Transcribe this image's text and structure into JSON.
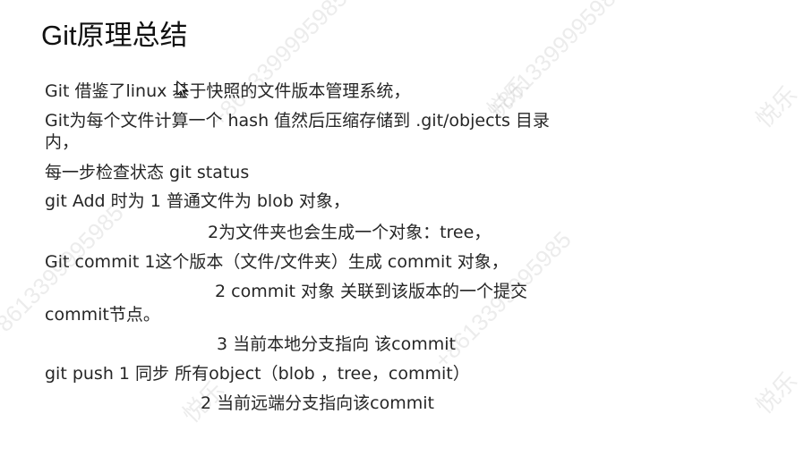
{
  "slide": {
    "title": "Git原理总结",
    "lines": [
      "Git 借鉴了linux 基于快照的文件版本管理系统，",
      "Git为每个文件计算一个 hash 值然后压缩存储到 .git/objects 目录",
      "内，",
      "每一步检查状态 git status",
      "git Add 时为 1 普通文件为 blob 对象，",
      "2为文件夹也会生成一个对象：tree，",
      "Git commit    1这个版本（文件/文件夹）生成 commit 对象，",
      "2 commit 对象 关联到该版本的一个提交",
      "commit节点。",
      "3 当前本地分支指向 该commit",
      "git push        1 同步 所有object（blob ，tree，commit）",
      "2  当前远端分支指向该commit"
    ]
  },
  "watermarks": [
    "+8613399995985",
    "+8613399995985",
    "+8613399995985",
    "+8613399995985",
    "悦乐",
    "悦乐",
    "悦乐",
    "悦乐"
  ]
}
